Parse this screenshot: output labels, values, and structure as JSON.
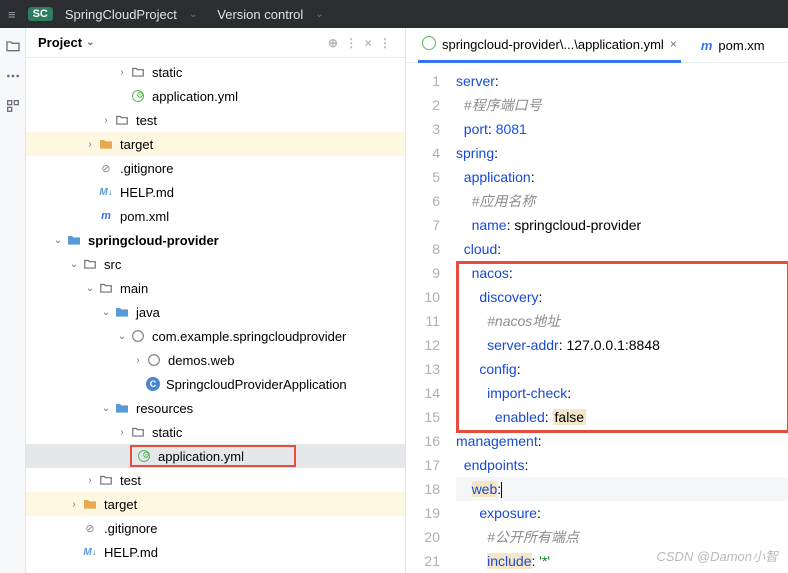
{
  "topbar": {
    "badge": "SC",
    "project": "SpringCloudProject",
    "vcs": "Version control"
  },
  "panel": {
    "title": "Project"
  },
  "tree": [
    {
      "indent": 90,
      "arrow": ">",
      "icon": "folder",
      "label": "static"
    },
    {
      "indent": 90,
      "arrow": "",
      "icon": "yml",
      "label": "application.yml"
    },
    {
      "indent": 74,
      "arrow": ">",
      "icon": "folder",
      "label": "test"
    },
    {
      "indent": 58,
      "arrow": ">",
      "icon": "folder-orange",
      "label": "target",
      "hl": true
    },
    {
      "indent": 58,
      "arrow": "",
      "icon": "gitignore",
      "label": ".gitignore"
    },
    {
      "indent": 58,
      "arrow": "",
      "icon": "md",
      "label": "HELP.md"
    },
    {
      "indent": 58,
      "arrow": "",
      "icon": "pom",
      "label": "pom.xml"
    },
    {
      "indent": 26,
      "arrow": "v",
      "icon": "folder-blue",
      "label": "springcloud-provider",
      "bold": true
    },
    {
      "indent": 42,
      "arrow": "v",
      "icon": "folder",
      "label": "src"
    },
    {
      "indent": 58,
      "arrow": "v",
      "icon": "folder",
      "label": "main"
    },
    {
      "indent": 74,
      "arrow": "v",
      "icon": "folder-blue",
      "label": "java"
    },
    {
      "indent": 90,
      "arrow": "v",
      "icon": "pkg",
      "label": "com.example.springcloudprovider"
    },
    {
      "indent": 106,
      "arrow": ">",
      "icon": "pkg",
      "label": "demos.web"
    },
    {
      "indent": 106,
      "arrow": "",
      "icon": "class",
      "label": "SpringcloudProviderApplication"
    },
    {
      "indent": 74,
      "arrow": "v",
      "icon": "folder-blue",
      "label": "resources"
    },
    {
      "indent": 90,
      "arrow": ">",
      "icon": "folder",
      "label": "static"
    },
    {
      "indent": 90,
      "arrow": "",
      "icon": "yml",
      "label": "application.yml",
      "sel": true,
      "box": true
    },
    {
      "indent": 58,
      "arrow": ">",
      "icon": "folder",
      "label": "test"
    },
    {
      "indent": 42,
      "arrow": ">",
      "icon": "folder-orange",
      "label": "target",
      "hl": true
    },
    {
      "indent": 42,
      "arrow": "",
      "icon": "gitignore",
      "label": ".gitignore"
    },
    {
      "indent": 42,
      "arrow": "",
      "icon": "md",
      "label": "HELP.md"
    }
  ],
  "tabs": {
    "active": "springcloud-provider\\...\\application.yml",
    "inactive": "pom.xm"
  },
  "code": {
    "lines": [
      {
        "n": 1,
        "html": "<span class='k'>server</span>:"
      },
      {
        "n": 2,
        "html": "  <span class='c'>#程序端口号</span>"
      },
      {
        "n": 3,
        "html": "  <span class='k'>port</span>: <span class='n'>8081</span>"
      },
      {
        "n": 4,
        "html": "<span class='k'>spring</span>:"
      },
      {
        "n": 5,
        "html": "  <span class='k'>application</span>:"
      },
      {
        "n": 6,
        "html": "    <span class='c'>#应用名称</span>"
      },
      {
        "n": 7,
        "html": "    <span class='k'>name</span>: springcloud-provider"
      },
      {
        "n": 8,
        "html": "  <span class='k'>cloud</span>:"
      },
      {
        "n": 9,
        "html": "    <span class='k'>nacos</span>:"
      },
      {
        "n": 10,
        "html": "      <span class='k'>discovery</span>:"
      },
      {
        "n": 11,
        "html": "        <span class='c'>#nacos地址</span>"
      },
      {
        "n": 12,
        "html": "        <span class='k'>server-addr</span>: 127.0.0.1:8848"
      },
      {
        "n": 13,
        "html": "      <span class='k'>config</span>:"
      },
      {
        "n": 14,
        "html": "        <span class='k'>import-check</span>:"
      },
      {
        "n": 15,
        "html": "          <span class='k'>enabled</span>: <span class='bool'>false</span>"
      },
      {
        "n": 16,
        "html": "<span class='k'>management</span>:"
      },
      {
        "n": 17,
        "html": "  <span class='k'>endpoints</span>:"
      },
      {
        "n": 18,
        "html": "    <span class='k hl-key'>web</span>:<span class='cursor'></span>",
        "sel": true
      },
      {
        "n": 19,
        "html": "      <span class='k'>exposure</span>:"
      },
      {
        "n": 20,
        "html": "        <span class='c'>#公开所有端点</span>"
      },
      {
        "n": 21,
        "html": "        <span class='k hl-key'>include</span>: <span class='s'>'*'</span>"
      }
    ]
  },
  "watermark": "CSDN @Damon小智"
}
